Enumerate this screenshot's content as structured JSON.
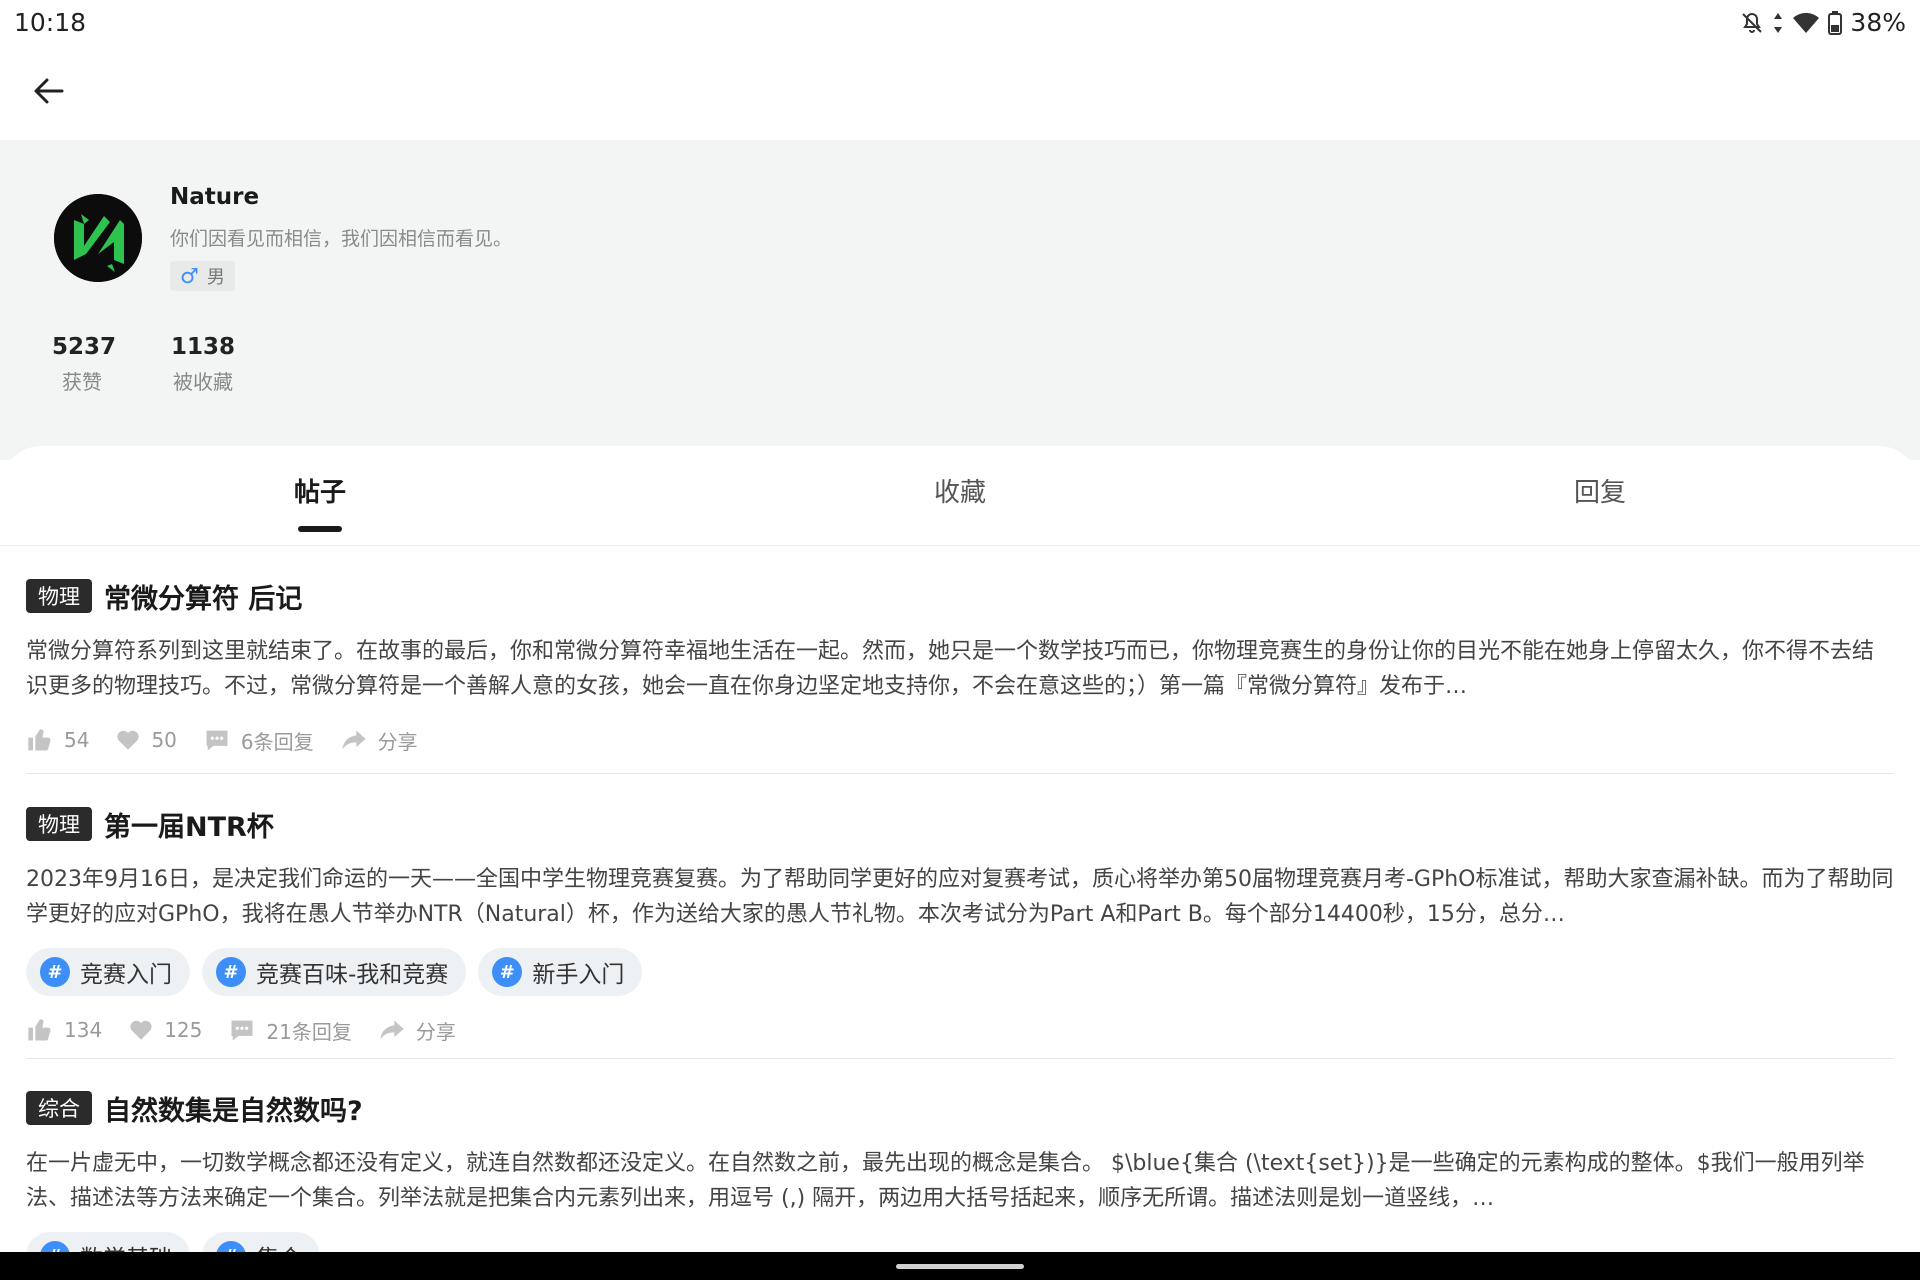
{
  "status_bar": {
    "time": "10:18",
    "battery": "38%",
    "icons": [
      "notifications-off-icon",
      "data-arrows-icon",
      "wifi-icon",
      "battery-icon"
    ]
  },
  "topbar": {
    "back_icon": "arrow-left-icon"
  },
  "profile": {
    "name": "Nature",
    "bio": "你们因看见而相信，我们因相信而看见。",
    "gender_symbol": "♂",
    "gender": "男",
    "stats": [
      {
        "value": "5237",
        "label": "获赞"
      },
      {
        "value": "1138",
        "label": "被收藏"
      }
    ]
  },
  "tabs": [
    {
      "label": "帖子",
      "active": true
    },
    {
      "label": "收藏",
      "active": false
    },
    {
      "label": "回复",
      "active": false
    }
  ],
  "posts": [
    {
      "category": "物理",
      "title": "常微分算符 后记",
      "body": "常微分算符系列到这里就结束了。在故事的最后，你和常微分算符幸福地生活在一起。然而，她只是一个数学技巧而已，你物理竞赛生的身份让你的目光不能在她身上停留太久，你不得不去结识更多的物理技巧。不过，常微分算符是一个善解人意的女孩，她会一直在你身边坚定地支持你，不会在意这些的；）第一篇『常微分算符』发布于…",
      "topics": [],
      "likes": "54",
      "favorites": "50",
      "replies": "6条回复",
      "share": "分享"
    },
    {
      "category": "物理",
      "title": "第一届NTR杯",
      "body": "2023年9月16日，是决定我们命运的一天——全国中学生物理竞赛复赛。为了帮助同学更好的应对复赛考试，质心将举办第50届物理竞赛月考-GPhO标准试，帮助大家查漏补缺。而为了帮助同学更好的应对GPhO，我将在愚人节举办NTR（Natural）杯，作为送给大家的愚人节礼物。本次考试分为Part A和Part B。每个部分14400秒，15分，总分…",
      "topics": [
        "竞赛入门",
        "竞赛百味-我和竞赛",
        "新手入门"
      ],
      "likes": "134",
      "favorites": "125",
      "replies": "21条回复",
      "share": "分享"
    },
    {
      "category": "综合",
      "title": "自然数集是自然数吗?",
      "body": "在一片虚无中，一切数学概念都还没有定义，就连自然数都还没定义。在自然数之前，最先出现的概念是集合。          $\\blue{集合 (\\text{set})}是一些确定的元素构成的整体。$我们一般用列举法、描述法等方法来确定一个集合。列举法就是把集合内元素列出来，用逗号 (,) 隔开，两边用大括号括起来，顺序无所谓。描述法则是划一道竖线，…",
      "topics": [
        "数学基础",
        "集合"
      ],
      "likes": "",
      "favorites": "",
      "replies": "",
      "share": ""
    }
  ],
  "colors": {
    "accent": "#3d8ef7",
    "profile_bg": "#f3f5f5",
    "category_bg": "#2b2b2b",
    "topic_bg": "#eef1f4"
  }
}
